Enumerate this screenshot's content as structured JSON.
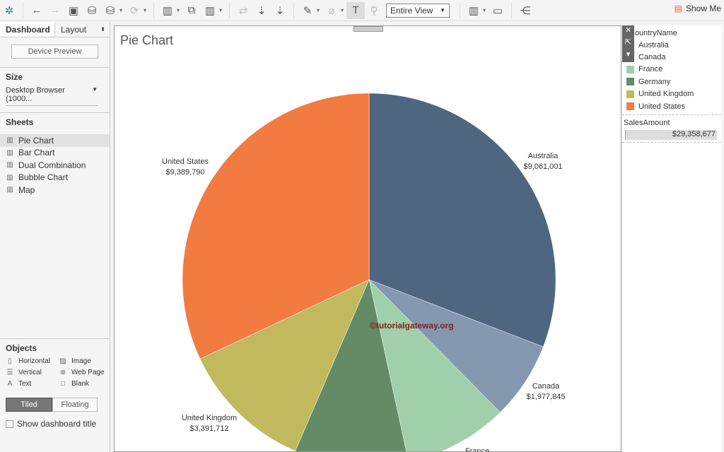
{
  "toolbar": {
    "view_select": "Entire View",
    "show_me": "Show Me"
  },
  "left_panel": {
    "tabs": [
      "Dashboard",
      "Layout"
    ],
    "device_preview": "Device Preview",
    "size_heading": "Size",
    "size_value": "Desktop Browser (1000...",
    "sheets_heading": "Sheets",
    "sheets": [
      "Pie Chart",
      "Bar Chart",
      "Dual Combination",
      "Bubble Chart",
      "Map"
    ],
    "objects_heading": "Objects",
    "objects": [
      "Horizontal",
      "Image",
      "Vertical",
      "Web Page",
      "Text",
      "Blank"
    ],
    "tiled": "Tiled",
    "floating": "Floating",
    "show_title": "Show dashboard title"
  },
  "legend": {
    "title": "CountryName",
    "sales_title": "SalesAmount",
    "sales_total": "$29,358,677"
  },
  "watermark": "©tutorialgateway.org",
  "chart_data": {
    "type": "pie",
    "title": "Pie Chart",
    "categories": [
      "Australia",
      "Canada",
      "France",
      "Germany",
      "United Kingdom",
      "United States"
    ],
    "values": [
      9061001,
      1977845,
      2644017,
      2894312,
      3391712,
      9389790
    ],
    "labels": [
      "$9,061,001",
      "$1,977,845",
      "",
      "",
      "$3,391,712",
      "$9,389,790"
    ],
    "colors": [
      "#4e667f",
      "#8499b0",
      "#a1cfa9",
      "#628b66",
      "#c2b95e",
      "#f27b42"
    ],
    "total": 29358677
  }
}
